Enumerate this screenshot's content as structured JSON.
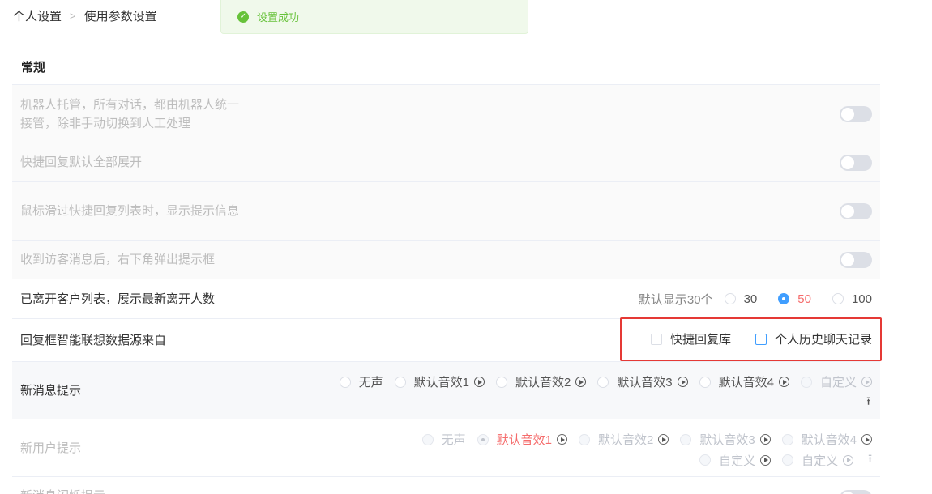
{
  "breadcrumb": {
    "root": "个人设置",
    "current": "使用参数设置"
  },
  "toast": {
    "message": "设置成功"
  },
  "section": {
    "title": "常规"
  },
  "settings": {
    "robot": {
      "label": "机器人托管，所有对话，都由机器人统一接管，除非手动切换到人工处理",
      "on": false
    },
    "expand": {
      "label": "快捷回复默认全部展开",
      "on": false
    },
    "hover": {
      "label": "鼠标滑过快捷回复列表时，显示提示信息",
      "on": false
    },
    "popup": {
      "label": "收到访客消息后，右下角弹出提示框",
      "on": false
    },
    "left_customers": {
      "label": "已离开客户列表，展示最新离开人数",
      "hint": "默认显示30个",
      "options": [
        "30",
        "50",
        "100"
      ],
      "selected": "50"
    },
    "suggest_source": {
      "label": "回复框智能联想数据源来自",
      "options": [
        "快捷回复库",
        "个人历史聊天记录"
      ]
    },
    "new_message": {
      "label": "新消息提示",
      "options": [
        "无声",
        "默认音效1",
        "默认音效2",
        "默认音效3",
        "默认音效4",
        "自定义"
      ]
    },
    "new_user": {
      "label": "新用户提示",
      "options": [
        "无声",
        "默认音效1",
        "默认音效2",
        "默认音效3",
        "默认音效4"
      ],
      "selected": "默认音效1",
      "custom": [
        "自定义",
        "自定义"
      ]
    },
    "flash": {
      "label": "新消息闪烁提示"
    }
  }
}
